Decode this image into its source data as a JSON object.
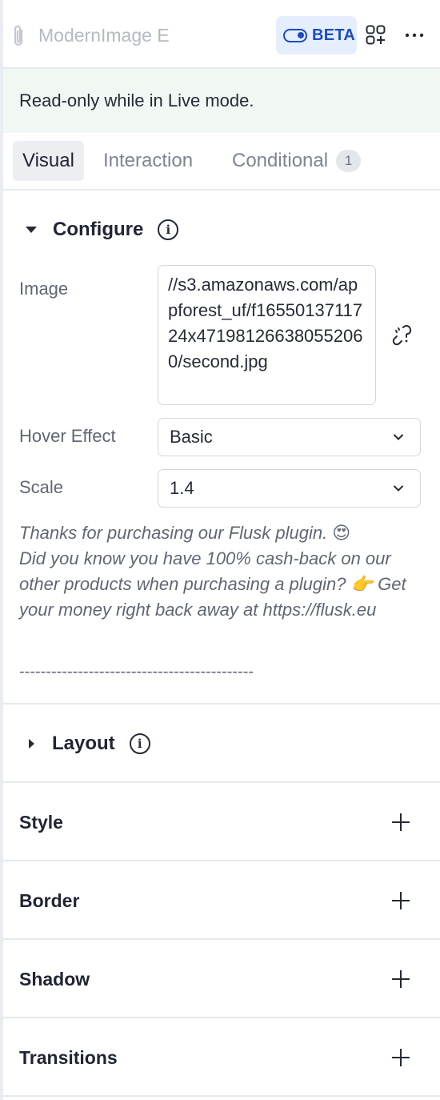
{
  "header": {
    "element_name": "ModernImage E",
    "beta_label": "BETA",
    "icons": {
      "attach": "paperclip-icon",
      "beta_toggle": "toggle-icon",
      "add_element": "add-element-icon",
      "more": "more-horizontal-icon"
    },
    "accent": "#1f4bbf"
  },
  "notice": {
    "text": "Read-only while in Live mode."
  },
  "tabs": [
    {
      "label": "Visual",
      "active": true
    },
    {
      "label": "Interaction",
      "active": false
    },
    {
      "label": "Conditional",
      "active": false,
      "count": "1"
    }
  ],
  "configure": {
    "title": "Configure",
    "image": {
      "label": "Image",
      "value": "//s3.amazonaws.com/appforest_uf/f1655013711724x471981266380552060/second.jpg"
    },
    "hover_effect": {
      "label": "Hover Effect",
      "value": "Basic"
    },
    "scale": {
      "label": "Scale",
      "value": "1.4"
    },
    "promo_line1": "Thanks for purchasing our Flusk plugin. 😍",
    "promo_line2": "Did you know you have 100% cash-back on our other products when purchasing a plugin? 👉 Get your money right back away at https://flusk.eu",
    "separator": "--------------------------------------------"
  },
  "sections": {
    "layout": "Layout",
    "style": "Style",
    "border": "Border",
    "shadow": "Shadow",
    "transitions": "Transitions"
  }
}
